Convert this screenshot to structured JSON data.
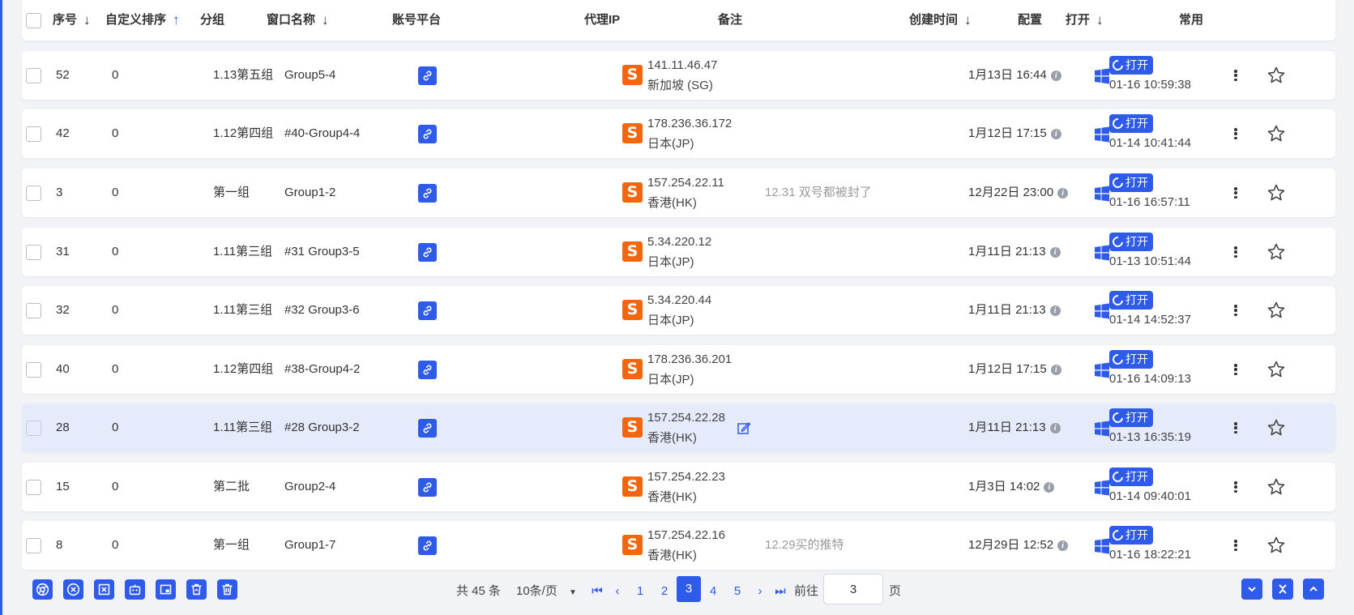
{
  "header": {
    "index": "序号",
    "custom_sort": "自定义排序",
    "group": "分组",
    "window_name": "窗口名称",
    "platform": "账号平台",
    "proxy_ip": "代理IP",
    "note": "备注",
    "created": "创建时间",
    "config": "配置",
    "open": "打开",
    "favorite": "常用",
    "sort_down": "↓",
    "sort_up": "↑"
  },
  "rows": [
    {
      "index": "52",
      "sort": "0",
      "group": "1.13第五组",
      "name": "Group5-4",
      "ip": "141.11.46.47",
      "region": "新加坡 (SG)",
      "note": "",
      "created": "1月13日 16:44",
      "open_label": "打开",
      "open_time": "01-16 10:59:38",
      "proxy_badge": "S",
      "selected": false
    },
    {
      "index": "42",
      "sort": "0",
      "group": "1.12第四组",
      "name": "#40-Group4-4",
      "ip": "178.236.36.172",
      "region": "日本(JP)",
      "note": "",
      "created": "1月12日 17:15",
      "open_label": "打开",
      "open_time": "01-14 10:41:44",
      "proxy_badge": "S",
      "selected": false
    },
    {
      "index": "3",
      "sort": "0",
      "group": "第一组",
      "name": "Group1-2",
      "ip": "157.254.22.11",
      "region": "香港(HK)",
      "note": "12.31 双号都被封了",
      "created": "12月22日 23:00",
      "open_label": "打开",
      "open_time": "01-16 16:57:11",
      "proxy_badge": "S",
      "selected": false
    },
    {
      "index": "31",
      "sort": "0",
      "group": "1.11第三组",
      "name": "#31 Group3-5",
      "ip": "5.34.220.12",
      "region": "日本(JP)",
      "note": "",
      "created": "1月11日 21:13",
      "open_label": "打开",
      "open_time": "01-13 10:51:44",
      "proxy_badge": "S",
      "selected": false
    },
    {
      "index": "32",
      "sort": "0",
      "group": "1.11第三组",
      "name": "#32 Group3-6",
      "ip": "5.34.220.44",
      "region": "日本(JP)",
      "note": "",
      "created": "1月11日 21:13",
      "open_label": "打开",
      "open_time": "01-14 14:52:37",
      "proxy_badge": "S",
      "selected": false
    },
    {
      "index": "40",
      "sort": "0",
      "group": "1.12第四组",
      "name": "#38-Group4-2",
      "ip": "178.236.36.201",
      "region": "日本(JP)",
      "note": "",
      "created": "1月12日 17:15",
      "open_label": "打开",
      "open_time": "01-16 14:09:13",
      "proxy_badge": "S",
      "selected": false
    },
    {
      "index": "28",
      "sort": "0",
      "group": "1.11第三组",
      "name": "#28 Group3-2",
      "ip": "157.254.22.28",
      "region": "香港(HK)",
      "note": "",
      "created": "1月11日 21:13",
      "open_label": "打开",
      "open_time": "01-13 16:35:19",
      "proxy_badge": "S",
      "selected": true
    },
    {
      "index": "15",
      "sort": "0",
      "group": "第二批",
      "name": "Group2-4",
      "ip": "157.254.22.23",
      "region": "香港(HK)",
      "note": "",
      "created": "1月3日 14:02",
      "open_label": "打开",
      "open_time": "01-14 09:40:01",
      "proxy_badge": "S",
      "selected": false
    },
    {
      "index": "8",
      "sort": "0",
      "group": "第一组",
      "name": "Group1-7",
      "ip": "157.254.22.16",
      "region": "香港(HK)",
      "note": "12.29买的推特",
      "created": "12月29日 12:52",
      "open_label": "打开",
      "open_time": "01-16 18:22:21",
      "proxy_badge": "S",
      "selected": false
    }
  ],
  "pagination": {
    "total": "共 45 条",
    "page_size": "10条/页",
    "pages": [
      "1",
      "2",
      "3",
      "4",
      "5"
    ],
    "current_page": "3",
    "goto_label": "前往",
    "goto_value": "3",
    "page_suffix": "页"
  },
  "toolbar": {
    "icons": [
      "chrome-icon",
      "close-circle-icon",
      "close-square-icon",
      "robot-icon",
      "window-icon",
      "trash-restore-icon",
      "trash-icon"
    ]
  },
  "colors": {
    "accent": "#2f5bea",
    "proxy_badge": "#f5650b",
    "selected_row": "#e6ebfc"
  }
}
